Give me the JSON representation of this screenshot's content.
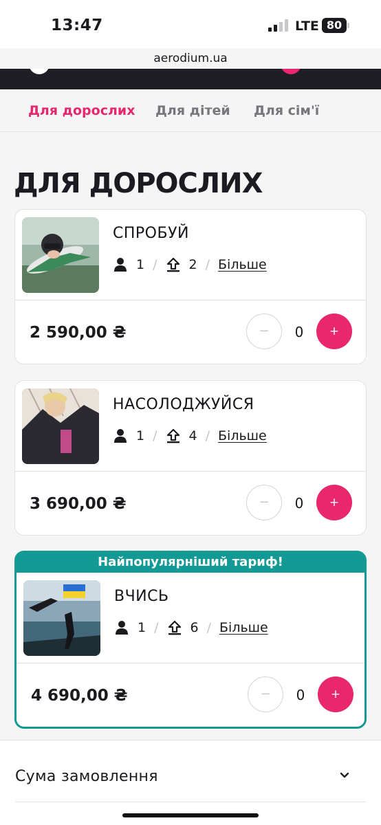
{
  "status_bar": {
    "time": "13:47",
    "network": "LTE",
    "battery": "80"
  },
  "browser": {
    "url": "aerodium.ua"
  },
  "tabs": [
    {
      "label": "Для дорослих",
      "active": true
    },
    {
      "label": "Для дітей",
      "active": false
    },
    {
      "label": "Для сім'ї",
      "active": false
    }
  ],
  "page": {
    "title": "ДЛЯ ДОРОСЛИХ"
  },
  "products": [
    {
      "name": "СПРОБУЙ",
      "people": "1",
      "flights": "2",
      "more_label": "Більше",
      "price": "2 590,00 ₴",
      "quantity": "0",
      "minus": "−",
      "plus": "+",
      "badge": ""
    },
    {
      "name": "НАСОЛОДЖУЙСЯ",
      "people": "1",
      "flights": "4",
      "more_label": "Більше",
      "price": "3 690,00 ₴",
      "quantity": "0",
      "minus": "−",
      "plus": "+",
      "badge": ""
    },
    {
      "name": "ВЧИСЬ",
      "people": "1",
      "flights": "6",
      "more_label": "Більше",
      "price": "4 690,00 ₴",
      "quantity": "0",
      "minus": "−",
      "plus": "+",
      "badge": "Найпопулярніший тариф!"
    }
  ],
  "separator": "/",
  "summary": {
    "label": "Сума замовлення"
  },
  "colors": {
    "accent": "#e8276d",
    "popular": "#139a95",
    "header": "#1f1e24"
  },
  "icons": {
    "people": "person-icon",
    "flights": "upload-arrow-icon",
    "expand": "chevron-down-icon"
  }
}
